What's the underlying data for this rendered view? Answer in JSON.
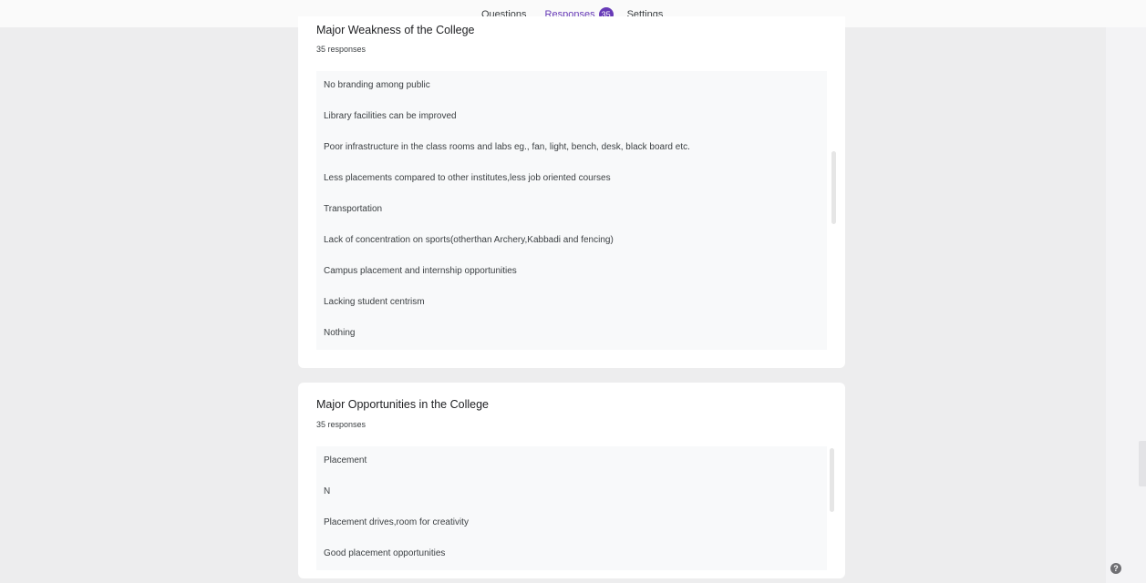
{
  "tabs": {
    "questions": "Questions",
    "responses": "Responses",
    "response_count": "35",
    "settings": "Settings"
  },
  "cards": [
    {
      "title": "Major Weakness of the College",
      "count": "35 responses",
      "responses": [
        "No branding among public",
        "Library facilities can be improved",
        "Poor infrastructure in the class rooms and labs eg., fan, light, bench, desk, black board etc.",
        "Less placements compared to other institutes,less job oriented courses",
        "Transportation",
        "Lack of concentration on sports(otherthan Archery,Kabbadi and fencing)",
        "Campus placement and internship opportunities",
        "Lacking student centrism",
        "Nothing"
      ]
    },
    {
      "title": "Major Opportunities in the College",
      "count": "35 responses",
      "responses": [
        "Placement",
        "N",
        "Placement drives,room for creativity",
        "Good placement opportunities"
      ]
    }
  ],
  "help_icon": "help-icon",
  "colors": {
    "accent": "#673ab7",
    "background": "#ededee",
    "card": "#ffffff"
  }
}
